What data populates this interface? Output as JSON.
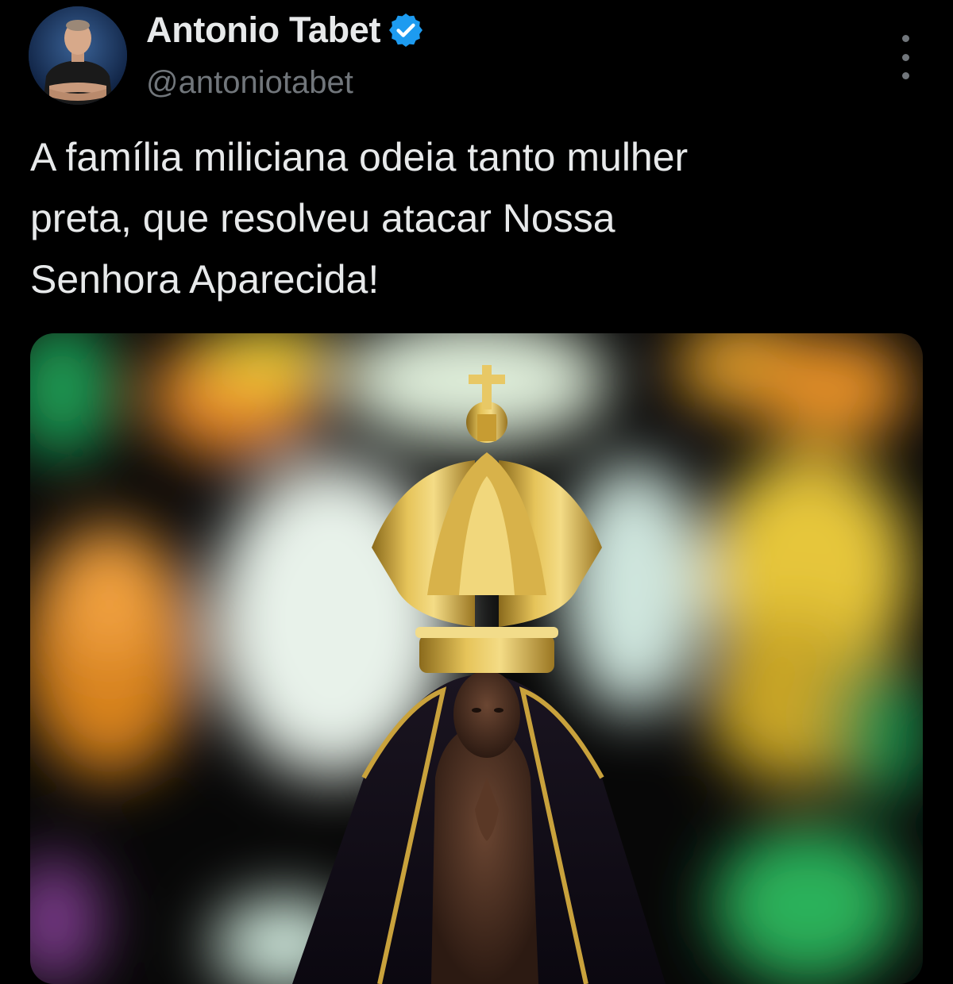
{
  "author": {
    "display_name": "Antonio Tabet",
    "handle": "@antoniotabet",
    "verified": true,
    "avatar": "profile-photo"
  },
  "tweet": {
    "text": "A família miliciana odeia tanto mulher\npreta, que resolveu atacar Nossa\nSenhora Aparecida!"
  },
  "media": {
    "description_icon": "statue-photo"
  },
  "colors": {
    "background": "#000000",
    "text_primary": "#e7e9ea",
    "text_secondary": "#71767b",
    "verified_badge": "#1d9bf0"
  },
  "icons": {
    "verified": "verified-badge-icon",
    "more": "more-options-icon"
  }
}
